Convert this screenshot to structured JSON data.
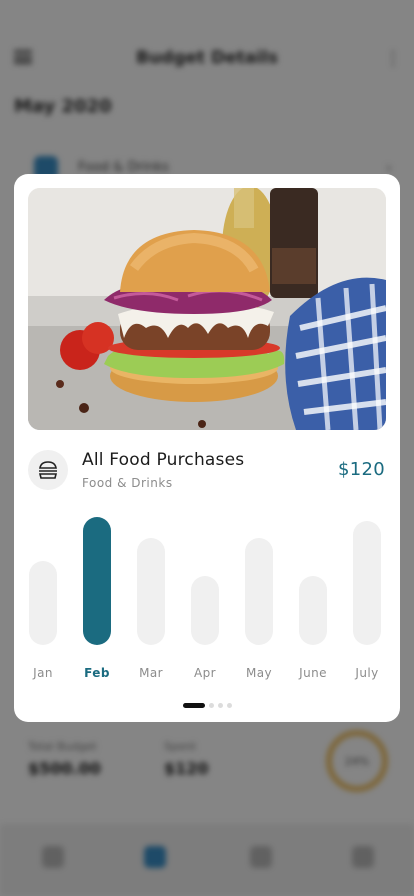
{
  "background": {
    "header": {
      "title": "Budget Details",
      "more_icon": "more-vertical-icon",
      "menu_icon": "menu-icon"
    },
    "date": "May 2020",
    "row": {
      "label": "Food & Drinks",
      "chevron_icon": "chevron-right-icon"
    },
    "stats": [
      {
        "label": "Total Budget",
        "value": "$500.00"
      },
      {
        "label": "Spent",
        "value": "$120"
      }
    ],
    "ring_value": "24%",
    "tabbar_icons": [
      "home-icon",
      "wallet-icon",
      "stats-icon",
      "profile-icon"
    ]
  },
  "card": {
    "image": "burger-photo",
    "category_icon": "burger-icon",
    "title": "All Food Purchases",
    "subtitle": "Food & Drinks",
    "amount": "$120",
    "accent_color": "#1b6b80",
    "page_indicator": {
      "count": 4,
      "active": 0
    }
  },
  "chart_data": {
    "type": "bar",
    "categories": [
      "Jan",
      "Feb",
      "Mar",
      "Apr",
      "May",
      "June",
      "July"
    ],
    "values": [
      88,
      134,
      112,
      72,
      112,
      72,
      130
    ],
    "highlighted": "Feb",
    "ylim": [
      0,
      140
    ]
  }
}
